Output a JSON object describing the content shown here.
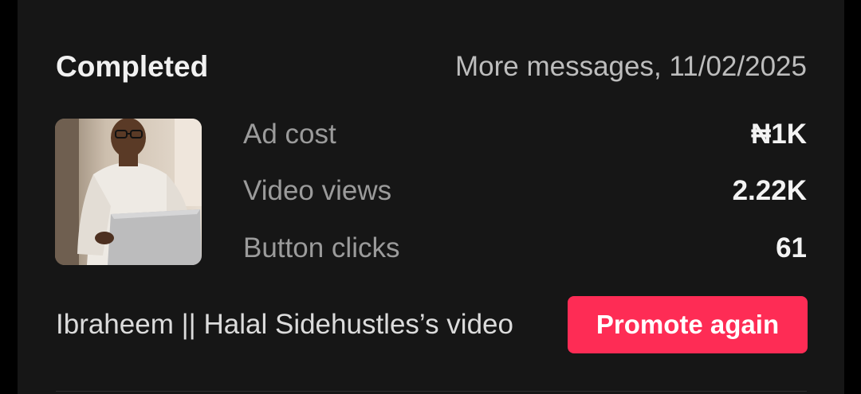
{
  "card": {
    "status": "Completed",
    "campaign_meta": "More messages, 11/02/2025",
    "thumbnail": {
      "icon": "video-thumbnail"
    },
    "metrics": [
      {
        "label": "Ad cost",
        "value": "₦1K"
      },
      {
        "label": "Video views",
        "value": "2.22K"
      },
      {
        "label": "Button clicks",
        "value": "61"
      }
    ],
    "video_title": "Ibraheem || Halal Sidehustles’s video",
    "promote_label": "Promote again"
  },
  "colors": {
    "background": "#161616",
    "accent": "#fe2c55",
    "primary_text": "#f1f1f1",
    "secondary_text": "#9b9b9b"
  }
}
